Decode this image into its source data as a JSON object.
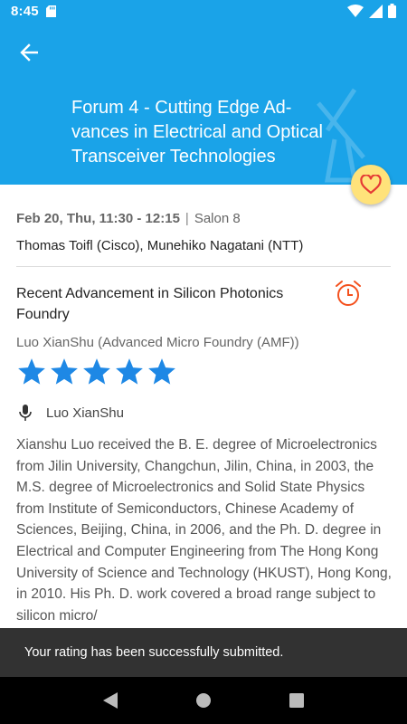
{
  "status_bar": {
    "time": "8:45"
  },
  "header": {
    "title": "Forum 4 - Cutting Edge Advances in Electrical and Optical Transceiver Technologies",
    "title_lines": [
      "Forum 4 - Cutting Edge Ad-",
      "vances in Electrical and Optical",
      "Transceiver Technologies"
    ],
    "color": "#1aa3e8"
  },
  "session": {
    "datetime": "Feb 20, Thu, 11:30 - 12:15",
    "separator": "|",
    "room": "Salon 8",
    "chairs": "Thomas Toifl (Cisco), Munehiko Nagatani (NTT)"
  },
  "talk": {
    "title": "Recent Advancement in Silicon Photonics Foundry",
    "affiliation": "Luo XianShu (Advanced Micro Foundry (AMF))",
    "rating": 5,
    "rating_max": 5,
    "star_color": "#1e88e5",
    "speaker": "Luo XianShu",
    "bio": "Xianshu Luo received the B. E. degree of Microelectronics from Jilin University, Changchun, Jilin, China, in 2003, the M.S. degree of Microelectronics and Solid State Physics from Institute of Semiconductors, Chinese Academy of Sciences, Beijing, China, in 2006, and the Ph. D. degree in Electrical and Computer Engineering from The Hong Kong University of Science and Technology (HKUST), Hong Kong, in 2010. His Ph. D. work covered a broad range subject to silicon micro/"
  },
  "icons": {
    "back": "arrow-left-icon",
    "favorite": "heart-outline-icon",
    "alarm": "alarm-clock-icon",
    "speaker": "microphone-icon"
  },
  "snackbar": {
    "message": "Your rating has been successfully submitted."
  },
  "accents": {
    "favorite_bg": "#ffe27a",
    "heart": "#e53935",
    "alarm": "#f4511e"
  }
}
